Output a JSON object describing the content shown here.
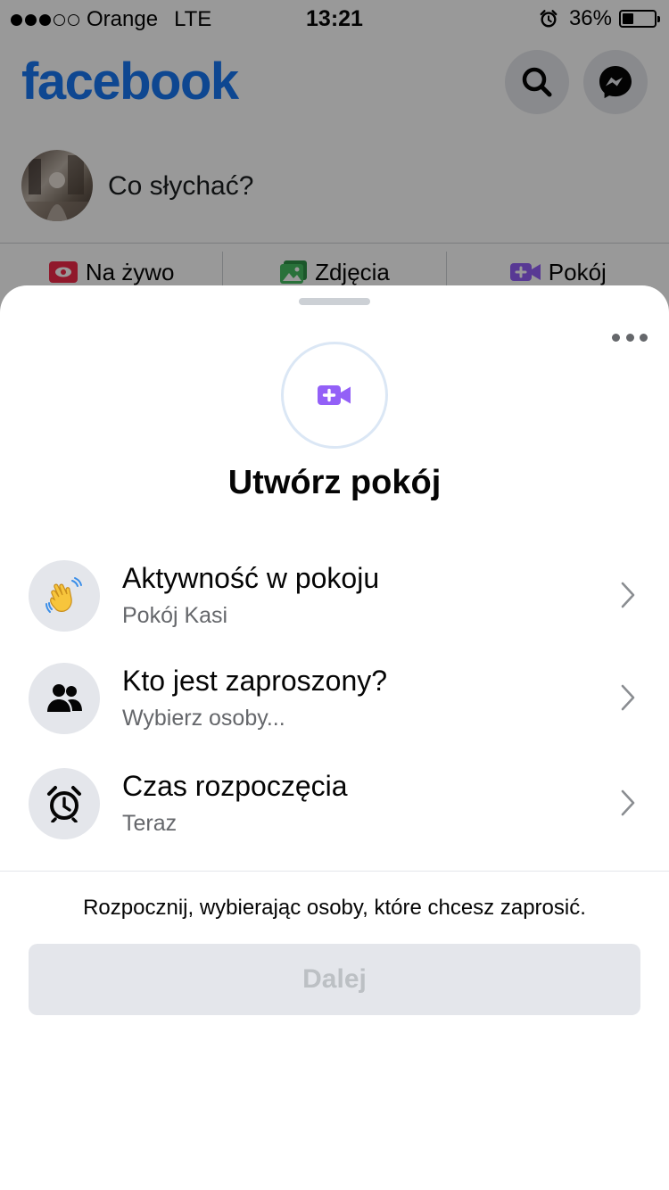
{
  "status_bar": {
    "carrier": "Orange",
    "network": "LTE",
    "time": "13:21",
    "battery": "36%",
    "battery_level": 0.36,
    "signal_dots_filled": 3,
    "signal_dots_total": 5
  },
  "header": {
    "logo": "facebook",
    "brand_color": "#1877f2"
  },
  "composer": {
    "placeholder": "Co słychać?"
  },
  "actions": [
    {
      "label": "Na żywo",
      "icon": "live-video-icon",
      "color": "#f02849"
    },
    {
      "label": "Zdjęcia",
      "icon": "photo-icon",
      "color": "#45bd62"
    },
    {
      "label": "Pokój",
      "icon": "room-video-icon",
      "color": "#9360f7"
    }
  ],
  "sheet": {
    "title": "Utwórz pokój",
    "options": [
      {
        "title": "Aktywność w pokoju",
        "subtitle": "Pokój Kasi",
        "icon": "waving-hand-icon"
      },
      {
        "title": "Kto jest zaproszony?",
        "subtitle": "Wybierz osoby...",
        "icon": "people-icon"
      },
      {
        "title": "Czas rozpoczęcia",
        "subtitle": "Teraz",
        "icon": "alarm-clock-icon"
      }
    ],
    "hint": "Rozpocznij, wybierając osoby, które chcesz zaprosić.",
    "next_label": "Dalej",
    "accent_color": "#9360f7"
  }
}
